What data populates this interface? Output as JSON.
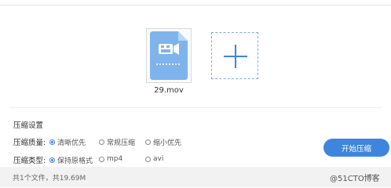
{
  "file": {
    "name": "29.mov",
    "icon": "video-file-icon"
  },
  "add_button": {
    "icon": "plus-icon"
  },
  "settings": {
    "title": "压缩设置",
    "quality": {
      "label": "压缩质量:",
      "options": [
        "清晰优先",
        "常规压缩",
        "缩小优先"
      ],
      "selected": "清晰优先"
    },
    "type": {
      "label": "压缩类型:",
      "options": [
        "保持原格式",
        "mp4",
        "avi"
      ],
      "selected": "保持原格式"
    }
  },
  "start_button": {
    "label": "开始压缩"
  },
  "summary": "共1个文件，共19.69M",
  "watermark": "@51CTO博客",
  "colors": {
    "accent": "#3e86dd",
    "file_icon": "#7fb3ec"
  }
}
